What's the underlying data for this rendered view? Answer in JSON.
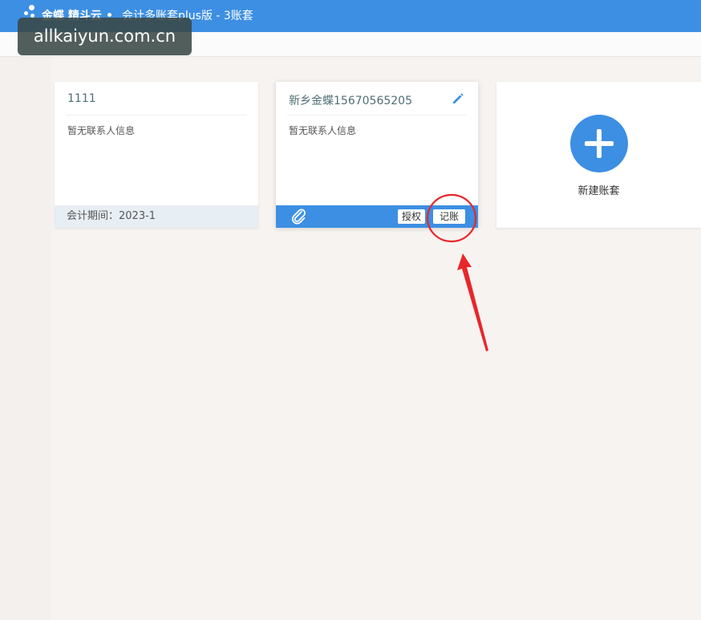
{
  "header": {
    "brand": "金蝶 精斗云",
    "app_title": "会计多账套plus版 - 3账套"
  },
  "watermark": "allkaiyun.com.cn",
  "cards": [
    {
      "title": "1111",
      "contact": "暂无联系人信息",
      "footer": "会计期间：2023-1"
    },
    {
      "title": "新乡金蝶15670565205",
      "contact": "暂无联系人信息",
      "buttons": {
        "authorize": "授权",
        "bookkeeping": "记账"
      }
    }
  ],
  "new_set": {
    "label": "新建账套"
  },
  "colors": {
    "accent": "#3d8fe3",
    "annotation": "#e8262a"
  },
  "icons": [
    "logo-icon",
    "edit-icon",
    "paperclip-icon",
    "plus-icon"
  ]
}
